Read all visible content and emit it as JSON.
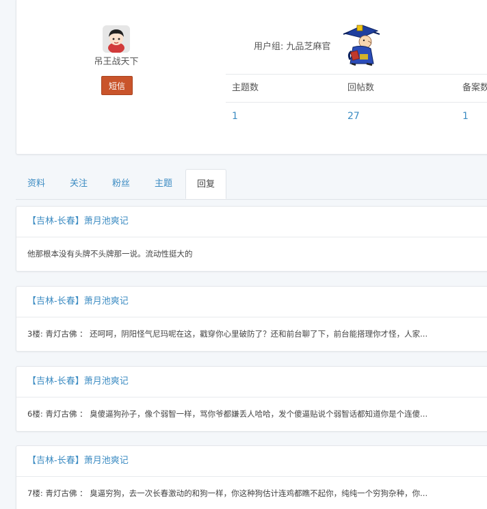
{
  "profile": {
    "username": "吊王战天下",
    "pm_label": "短信",
    "usergroup_text": "用户组: 九品芝麻官",
    "stats": {
      "headers": [
        "主题数",
        "回帖数",
        "备案数"
      ],
      "values": [
        "1",
        "27",
        "1"
      ]
    }
  },
  "tabs": [
    {
      "label": "资料"
    },
    {
      "label": "关注"
    },
    {
      "label": "粉丝"
    },
    {
      "label": "主题"
    },
    {
      "label": "回复",
      "active": true
    }
  ],
  "replies": [
    {
      "title": "【吉林-长春】萧月池爽记",
      "body": "他那根本没有头牌不头牌那一说。流动性挺大的"
    },
    {
      "title": "【吉林-长春】萧月池爽记",
      "body": "3楼: 青灯古佛 ： 还呵呵，阴阳怪气尼玛呢在这，戳穿你心里破防了？还和前台聊了下，前台能搭理你才怪，人家..."
    },
    {
      "title": "【吉林-长春】萧月池爽记",
      "body": "6楼: 青灯古佛 ： 臭傻逼狗孙子，像个弱智一样，骂你爷都嫌丢人哈哈，发个傻逼贴说个弱智话都知道你是个连傻..."
    },
    {
      "title": "【吉林-长春】萧月池爽记",
      "body": "7楼: 青灯古佛 ： 臭逼穷狗，去一次长春激动的和狗一样，你这种狗估计连鸡都瞧不起你，纯纯一个穷狗杂种，你..."
    }
  ],
  "colors": {
    "link": "#3b8bc2",
    "pm_button": "#c9542b",
    "background": "#f4f7fa"
  },
  "icons": {
    "avatar": "user-avatar",
    "usergroup": "official-cartoon-icon"
  }
}
